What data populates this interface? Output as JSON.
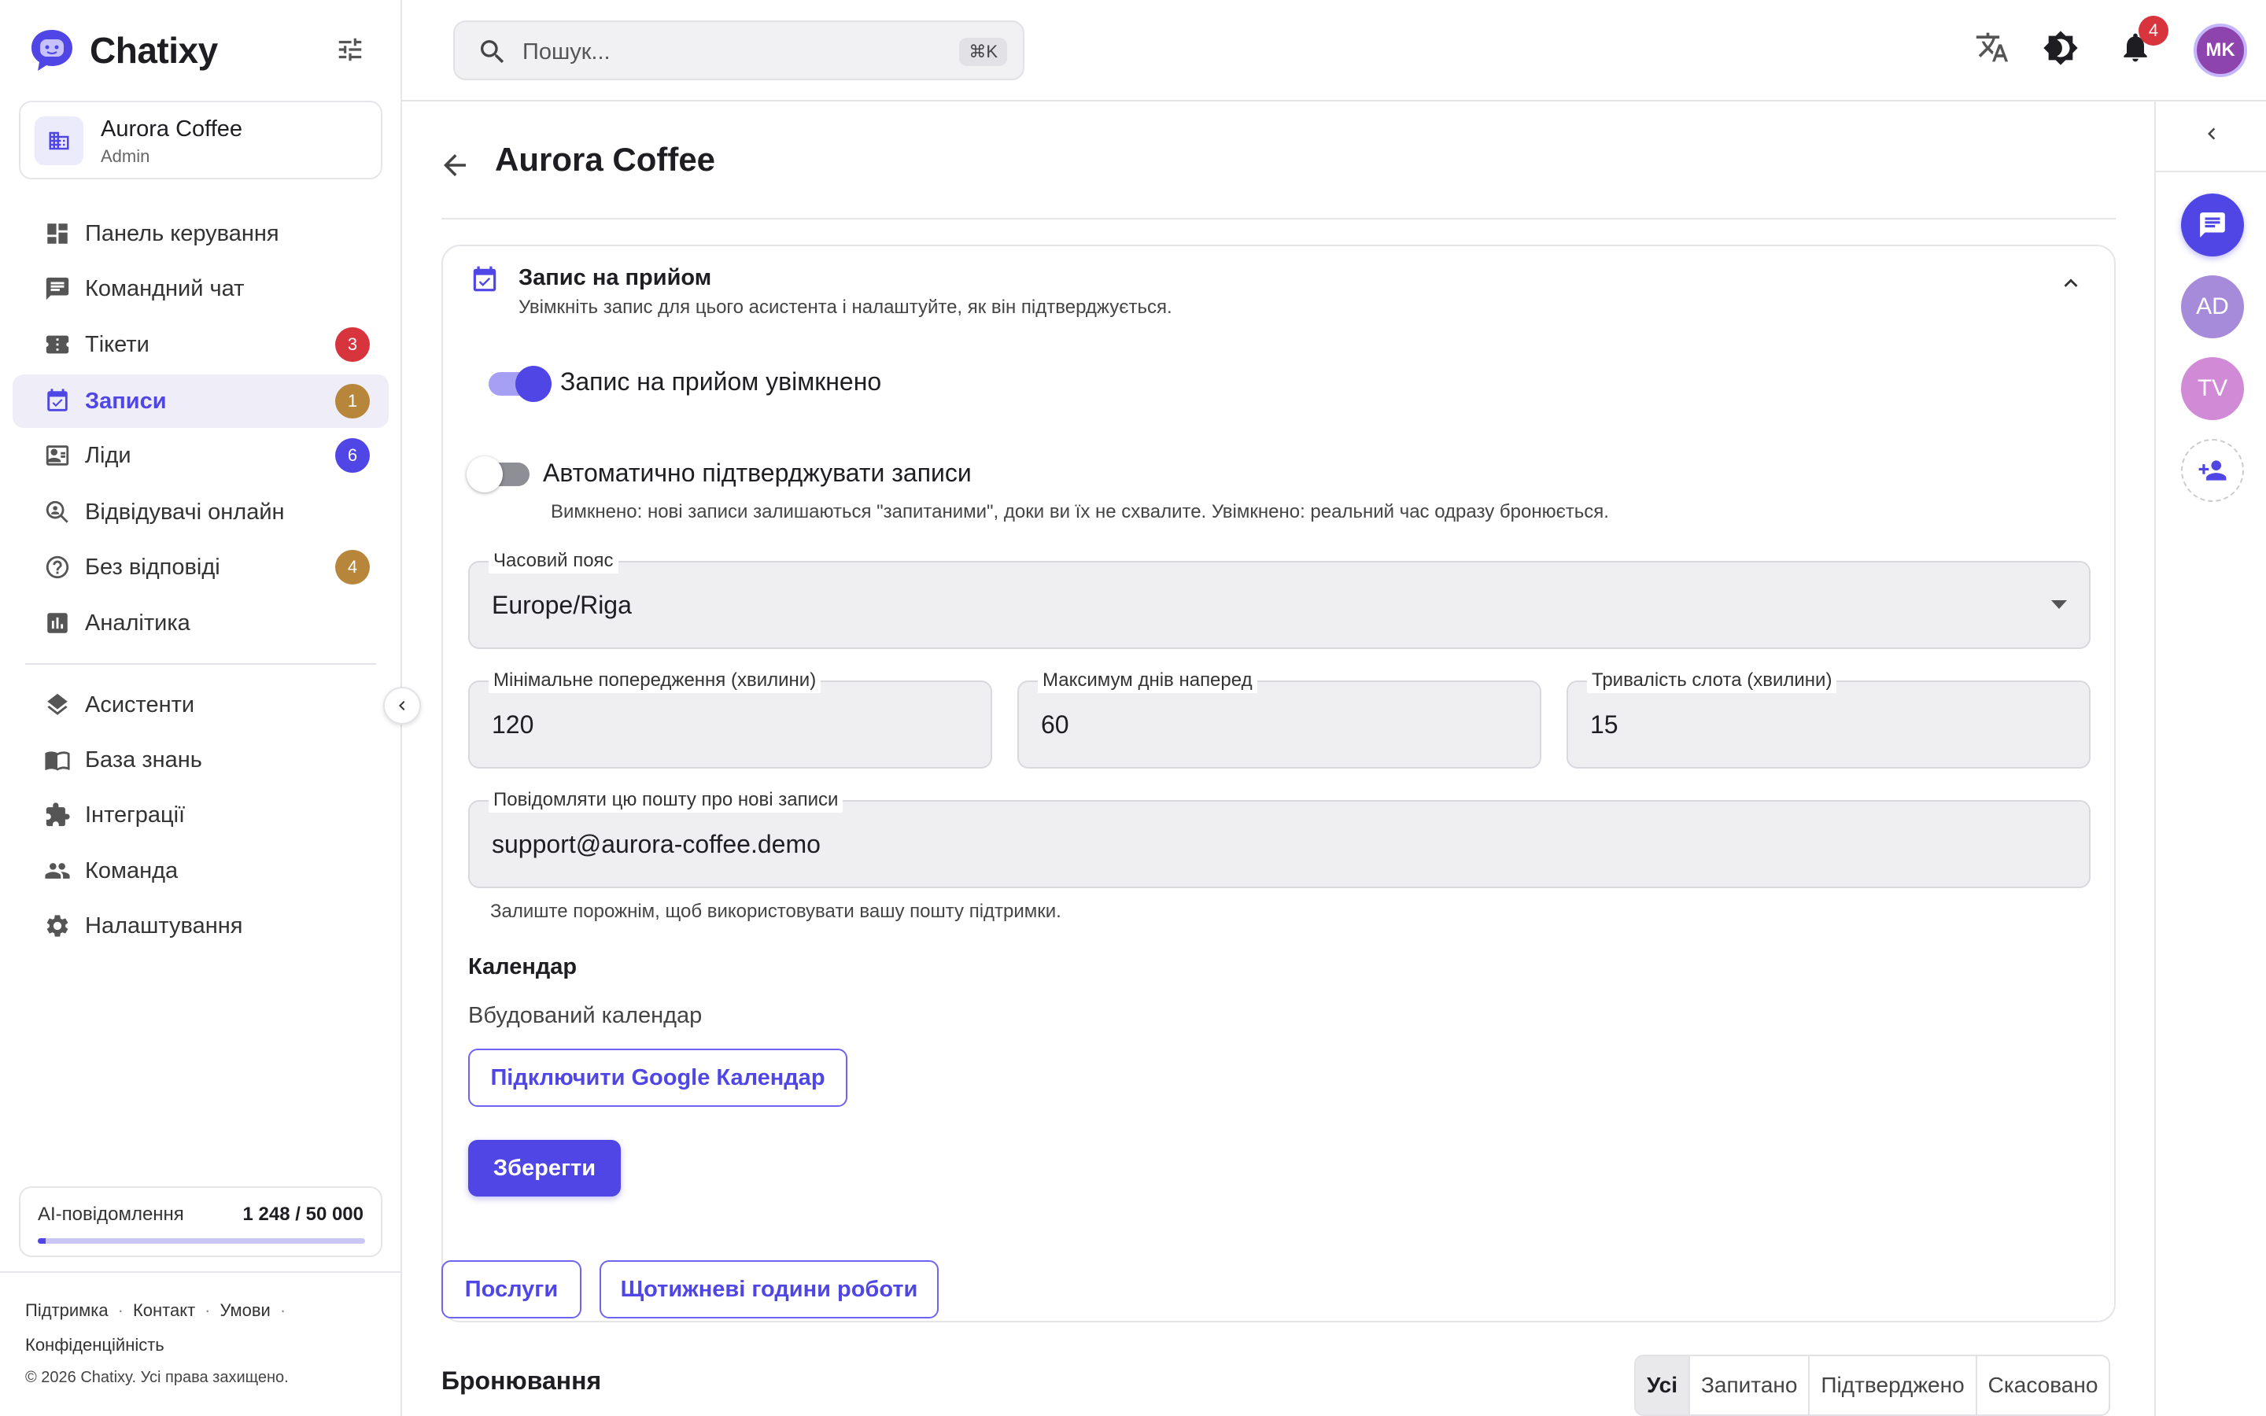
{
  "app": {
    "name": "Chatixy"
  },
  "org": {
    "name": "Aurora Coffee",
    "role": "Admin"
  },
  "nav": {
    "items": [
      {
        "label": "Панель керування",
        "icon": "dashboard-icon"
      },
      {
        "label": "Командний чат",
        "icon": "chat-icon"
      },
      {
        "label": "Тікети",
        "icon": "ticket-icon",
        "badge": "3"
      },
      {
        "label": "Записи",
        "icon": "calendar-check-icon",
        "badge": "1",
        "active": true
      },
      {
        "label": "Ліди",
        "icon": "contact-card-icon",
        "badge": "6"
      },
      {
        "label": "Відвідувачі онлайн",
        "icon": "visitors-search-icon"
      },
      {
        "label": "Без відповіді",
        "icon": "question-circle-icon",
        "badge": "4"
      },
      {
        "label": "Аналітика",
        "icon": "bar-chart-icon"
      },
      {
        "label": "Асистенти",
        "icon": "layers-icon"
      },
      {
        "label": "База знань",
        "icon": "book-icon"
      },
      {
        "label": "Інтеграції",
        "icon": "puzzle-icon"
      },
      {
        "label": "Команда",
        "icon": "people-icon"
      },
      {
        "label": "Налаштування",
        "icon": "gear-icon"
      }
    ]
  },
  "usage": {
    "label": "AI-повідомлення",
    "value": "1 248 / 50 000",
    "fraction": 0.025
  },
  "footer": {
    "links": [
      "Підтримка",
      "Контакт",
      "Умови",
      "Конфіденційність"
    ],
    "copyright": "© 2026 Chatixy. Усі права захищено."
  },
  "search": {
    "placeholder": "Пошук...",
    "shortcut": "⌘K"
  },
  "topbar": {
    "notifications": "4",
    "avatar_initials": "MK"
  },
  "page": {
    "title": "Aurora Coffee"
  },
  "booking_card": {
    "title": "Запис на прийом",
    "subtitle": "Увімкніть запис для цього асистента і налаштуйте, як він підтверджується.",
    "enable_label": "Запис на прийом увімкнено",
    "enable_on": true,
    "auto_label": "Автоматично підтверджувати записи",
    "auto_on": false,
    "auto_hint": "Вимкнено: нові записи залишаються \"запитаними\", доки ви їх не схвалите. Увімкнено: реальний час одразу бронюється.",
    "timezone_label": "Часовий пояс",
    "timezone_value": "Europe/Riga",
    "min_notice_label": "Мінімальне попередження (хвилини)",
    "min_notice_value": "120",
    "max_days_label": "Максимум днів наперед",
    "max_days_value": "60",
    "slot_label": "Тривалість слота (хвилини)",
    "slot_value": "15",
    "email_label": "Повідомляти цю пошту про нові записи",
    "email_value": "support@aurora-coffee.demo",
    "email_hint": "Залиште порожнім, щоб використовувати вашу пошту підтримки.",
    "calendar_heading": "Календар",
    "calendar_type": "Вбудований календар",
    "connect_google": "Підключити Google Календар",
    "save": "Зберегти"
  },
  "buttons": {
    "services": "Послуги",
    "weekly_hours": "Щотижневі години роботи"
  },
  "bookings": {
    "title": "Бронювання",
    "filters": [
      "Усі",
      "Запитано",
      "Підтверджено",
      "Скасовано"
    ]
  },
  "rail": {
    "avatars": [
      {
        "initials": "AD",
        "color": "#a78bdb"
      },
      {
        "initials": "TV",
        "color": "#d18ad6"
      }
    ]
  },
  "colors": {
    "accent": "#4f46e5",
    "badge_red": "#d8343d",
    "badge_amber": "#b7863a",
    "badge_indigo": "#4f46e5"
  }
}
